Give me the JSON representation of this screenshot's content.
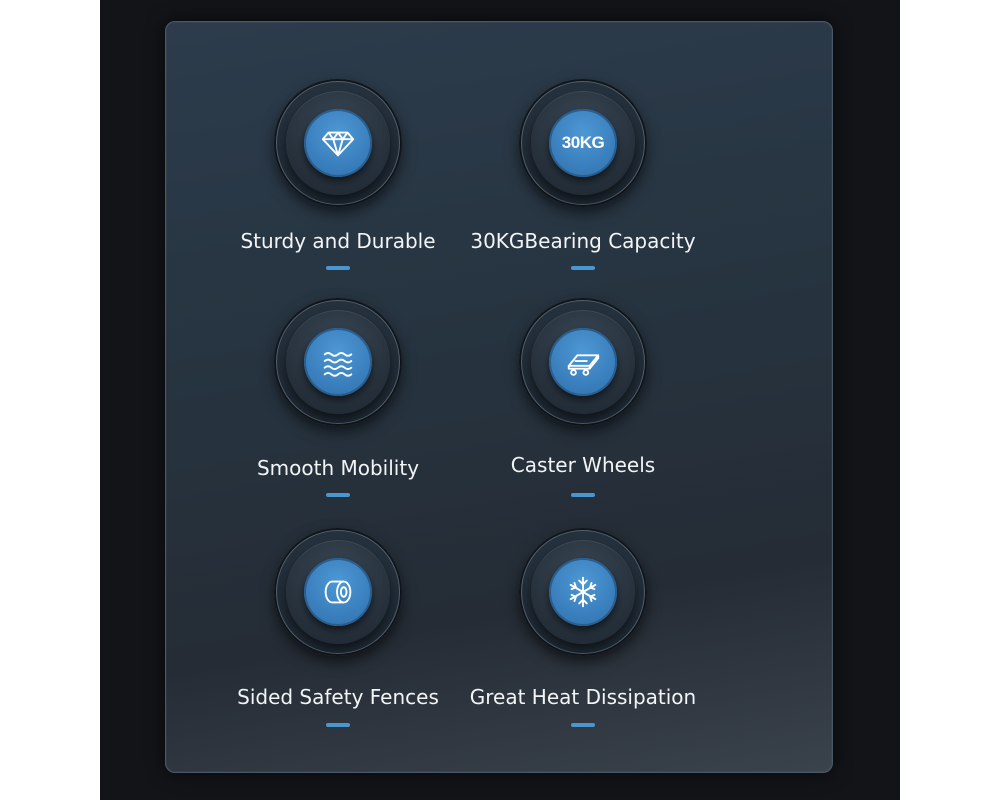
{
  "features": [
    {
      "label": "Sturdy and Durable",
      "icon": "diamond-icon"
    },
    {
      "label": "30KGBearing Capacity",
      "icon": "weight-badge-icon",
      "badge": "30KG"
    },
    {
      "label": "Smooth Mobility",
      "icon": "waves-icon"
    },
    {
      "label": "Caster Wheels",
      "icon": "caster-wheels-icon"
    },
    {
      "label": "Sided Safety Fences",
      "icon": "cylinder-icon"
    },
    {
      "label": "Great Heat Dissipation",
      "icon": "snowflake-icon"
    }
  ],
  "colors": {
    "backdrop": "#121418",
    "panel": "#26333f",
    "accent": "#3a7fbd",
    "text": "#f2f4f6"
  }
}
